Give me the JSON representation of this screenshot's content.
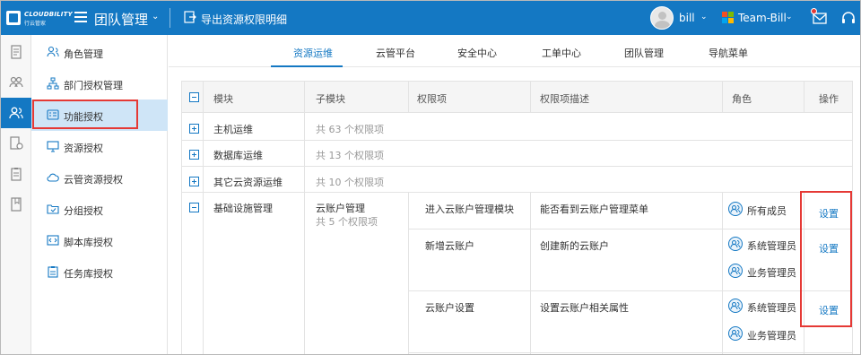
{
  "colors": {
    "primary": "#1478c3",
    "highlight": "#e53935",
    "active_row": "#cfe5f7"
  },
  "brand": {
    "name": "CLOUDBILITY",
    "subtitle": "行云管家"
  },
  "topbar": {
    "team_title": "团队管理",
    "export_label": "导出资源权限明细",
    "user_name": "bill",
    "team_name": "Team-Bill"
  },
  "rail": {
    "icons": [
      "document-icon",
      "group-icon",
      "people-icon",
      "settings-doc-icon",
      "clipboard-icon",
      "book-icon"
    ],
    "active_index": 2
  },
  "sidebar": {
    "items": [
      {
        "label": "角色管理",
        "icon": "role-icon"
      },
      {
        "label": "部门授权管理",
        "icon": "org-chart-icon"
      },
      {
        "label": "功能授权",
        "icon": "function-icon"
      },
      {
        "label": "资源授权",
        "icon": "monitor-icon"
      },
      {
        "label": "云管资源授权",
        "icon": "cloud-icon"
      },
      {
        "label": "分组授权",
        "icon": "group-folder-icon"
      },
      {
        "label": "脚本库授权",
        "icon": "script-icon"
      },
      {
        "label": "任务库授权",
        "icon": "task-icon"
      }
    ],
    "active_index": 2
  },
  "tabs": {
    "items": [
      "资源运维",
      "云管平台",
      "安全中心",
      "工单中心",
      "团队管理",
      "导航菜单"
    ],
    "active_index": 0
  },
  "table": {
    "headers": [
      "模块",
      "子模块",
      "权限项",
      "权限项描述",
      "角色",
      "操作"
    ],
    "collapsed_rows": [
      {
        "module": "主机运维",
        "summary": "共 63 个权限项"
      },
      {
        "module": "数据库运维",
        "summary": "共 13 个权限项"
      },
      {
        "module": "其它云资源运维",
        "summary": "共 10 个权限项"
      }
    ],
    "expanded": {
      "module": "基础设施管理",
      "submodule": "云账户管理",
      "submodule_summary": "共 5 个权限项",
      "permissions": [
        {
          "name": "进入云账户管理模块",
          "desc": "能否看到云账户管理菜单",
          "roles": [
            "所有成员"
          ],
          "action": "设置"
        },
        {
          "name": "新增云账户",
          "desc": "创建新的云账户",
          "roles": [
            "系统管理员",
            "业务管理员"
          ],
          "action": "设置"
        },
        {
          "name": "云账户设置",
          "desc": "设置云账户相关属性",
          "roles": [
            "系统管理员",
            "业务管理员"
          ],
          "action": "设置"
        }
      ]
    }
  }
}
